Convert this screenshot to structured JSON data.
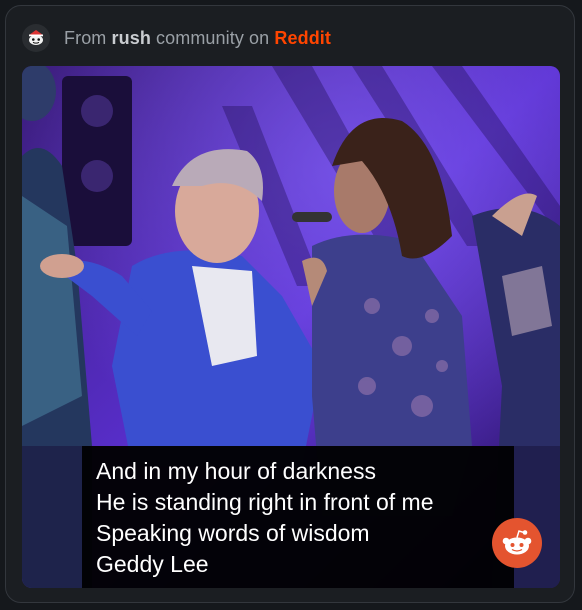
{
  "header": {
    "prefix": "From",
    "community": "rush",
    "middle": "community on",
    "platform": "Reddit",
    "avatar_icon": "snoo-icon"
  },
  "caption": {
    "lines": [
      "And in my hour of darkness",
      "He is standing right in front of me",
      "Speaking words of wisdom",
      "Geddy Lee"
    ]
  },
  "badge": {
    "icon": "reddit-logo-icon",
    "color": "#e4542f"
  },
  "colors": {
    "background": "#15181c",
    "card": "#1b1e22",
    "muted_text": "#9aa0a6",
    "brand": "#ff4500",
    "stage_light": "#5a2fd0"
  }
}
